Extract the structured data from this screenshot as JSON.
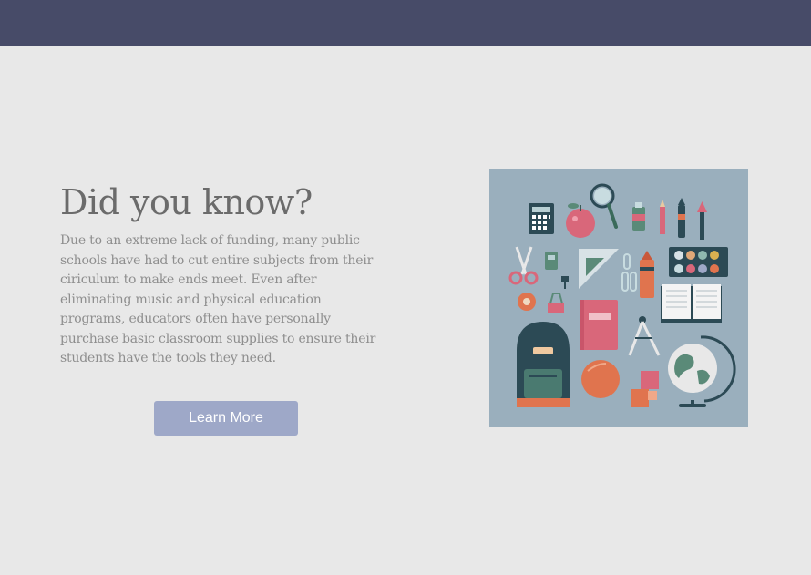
{
  "header": {
    "color": "#474b68"
  },
  "hero": {
    "heading": "Did you know?",
    "body": "Due to an extreme lack of funding, many public schools have had to cut entire subjects from their ciriculum to make ends meet. Even after eliminating music and physical education programs, educators often have personally purchase basic classroom supplies to ensure their students have the tools they need.",
    "cta_label": "Learn More",
    "cta_color": "#9ea8c8"
  },
  "illustration": {
    "background": "#9aafbd",
    "icons": [
      "calculator-icon",
      "apple-icon",
      "magnifier-icon",
      "glue-icon",
      "pencil-icon",
      "marker-icon",
      "brush-icon",
      "scissors-icon",
      "sharpener-icon",
      "set-square-icon",
      "paperclip-icon",
      "highlighter-icon",
      "paint-palette-icon",
      "push-pin-icon",
      "tape-icon",
      "binder-clip-icon",
      "notebook-icon",
      "compass-icon",
      "open-book-icon",
      "backpack-icon",
      "ball-icon",
      "sticky-notes-icon",
      "globe-icon"
    ]
  }
}
